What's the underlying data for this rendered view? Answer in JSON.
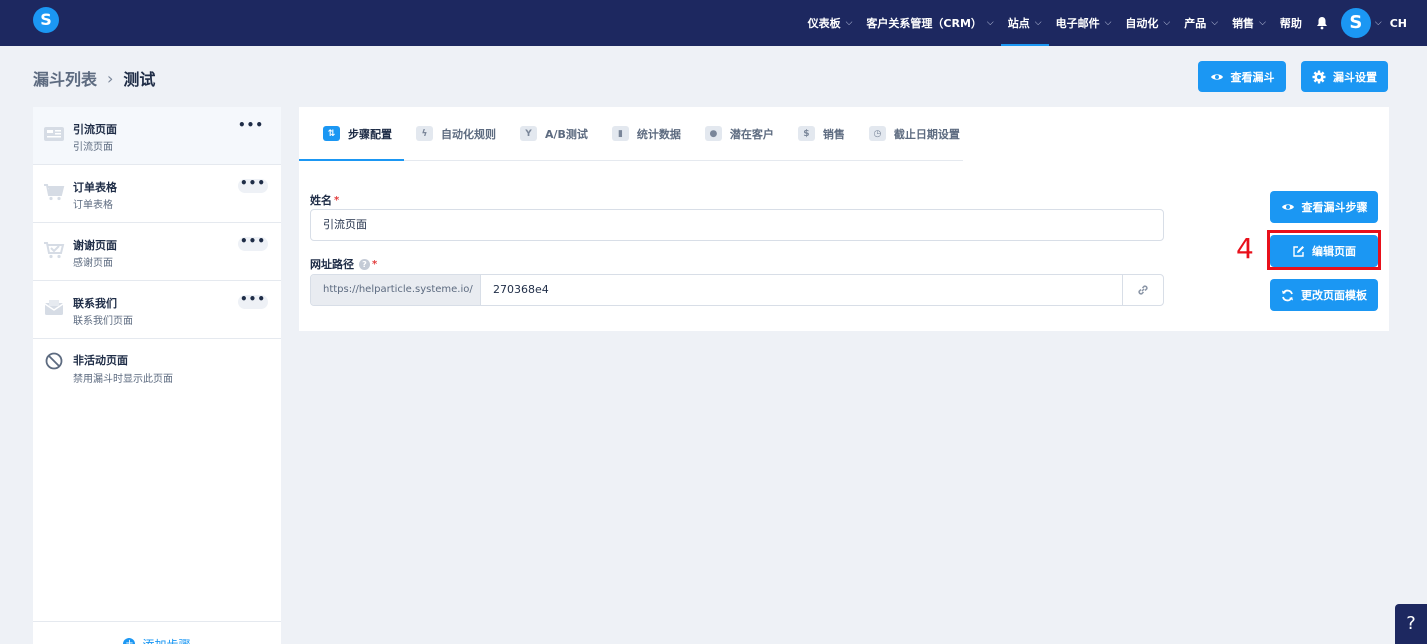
{
  "topbar": {
    "logo": "S",
    "nav": [
      {
        "label": "仪表板",
        "chevron": true
      },
      {
        "label": "客户关系管理（CRM）",
        "chevron": true
      },
      {
        "label": "站点",
        "chevron": true,
        "active": true
      },
      {
        "label": "电子邮件",
        "chevron": true
      },
      {
        "label": "自动化",
        "chevron": true
      },
      {
        "label": "产品",
        "chevron": true
      },
      {
        "label": "销售",
        "chevron": true
      },
      {
        "label": "帮助",
        "chevron": false
      }
    ],
    "avatar": "S",
    "user": "CH"
  },
  "breadcrumb": {
    "parent": "漏斗列表",
    "separator": "›",
    "current": "测试"
  },
  "header_buttons": {
    "view_funnel": "查看漏斗",
    "funnel_settings": "漏斗设置"
  },
  "sidebar": {
    "steps": [
      {
        "title": "引流页面",
        "subtitle": "引流页面",
        "icon": "page-icon"
      },
      {
        "title": "订单表格",
        "subtitle": "订单表格",
        "icon": "cart-icon"
      },
      {
        "title": "谢谢页面",
        "subtitle": "感谢页面",
        "icon": "cart-check-icon"
      },
      {
        "title": "联系我们",
        "subtitle": "联系我们页面",
        "icon": "mail-icon"
      }
    ],
    "inactive": {
      "title": "非活动页面",
      "subtitle": "禁用漏斗时显示此页面"
    },
    "more_label": "•••",
    "add_step": "添加步骤"
  },
  "tabs": [
    {
      "label": "步骤配置",
      "icon": "sliders-icon",
      "active": true
    },
    {
      "label": "自动化规则",
      "icon": "bolt-icon"
    },
    {
      "label": "A/B测试",
      "icon": "split-icon"
    },
    {
      "label": "统计数据",
      "icon": "bar-chart-icon"
    },
    {
      "label": "潜在客户",
      "icon": "users-icon"
    },
    {
      "label": "销售",
      "icon": "dollar-icon"
    },
    {
      "label": "截止日期设置",
      "icon": "clock-icon"
    }
  ],
  "form": {
    "name_label": "姓名",
    "name_value": "引流页面",
    "url_label": "网址路径",
    "url_prefix": "https://helparticle.systeme.io/",
    "url_value": "270368e4",
    "required_mark": "*"
  },
  "actions": {
    "view_step": "查看漏斗步骤",
    "edit_page": "编辑页面",
    "change_template": "更改页面模板"
  },
  "annotation": {
    "number": "4"
  },
  "help_fab": "?",
  "colors": {
    "nav_bg": "#1d2860",
    "accent": "#1b97f3",
    "highlight": "#e8101b"
  }
}
